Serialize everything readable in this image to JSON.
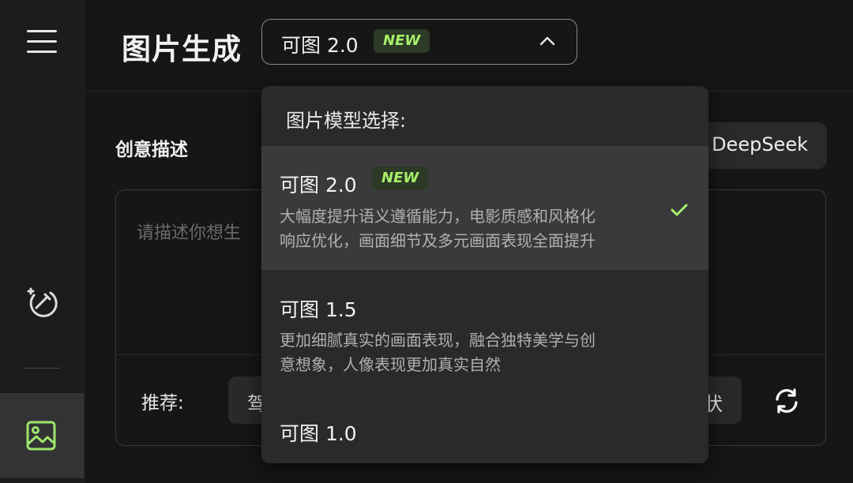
{
  "header": {
    "title": "图片生成",
    "model_select": {
      "value": "可图 2.0",
      "badge": "NEW"
    }
  },
  "main": {
    "section_title": "创意描述",
    "deepseek_button": "DeepSeek",
    "prompt_placeholder": "请描述你想生",
    "recommend_label": "推荐:",
    "chip_left": "驾",
    "chip_right": "状"
  },
  "dropdown": {
    "heading": "图片模型选择:",
    "options": [
      {
        "name": "可图 2.0",
        "badge": "NEW",
        "selected": true,
        "desc_line1": "大幅度提升语义遵循能力，电影质感和风格化",
        "desc_line2": "响应优化，画面细节及多元画面表现全面提升"
      },
      {
        "name": "可图 1.5",
        "badge": "",
        "selected": false,
        "desc_line1": "更加细腻真实的画面表现，融合独特美学与创",
        "desc_line2": "意想象，人像表现更加真实自然"
      },
      {
        "name": "可图 1.0",
        "badge": "",
        "selected": false,
        "desc_line1": "",
        "desc_line2": ""
      }
    ]
  },
  "colors": {
    "accent_green": "#a8f06a",
    "badge_bg": "#2c3a26",
    "check": "#a8f06a"
  },
  "icons": {
    "menu": "hamburger-icon",
    "magic": "magic-wand-icon",
    "image_nav": "image-icon",
    "chevron": "chevron-up-icon",
    "check": "check-icon",
    "refresh": "refresh-icon"
  }
}
